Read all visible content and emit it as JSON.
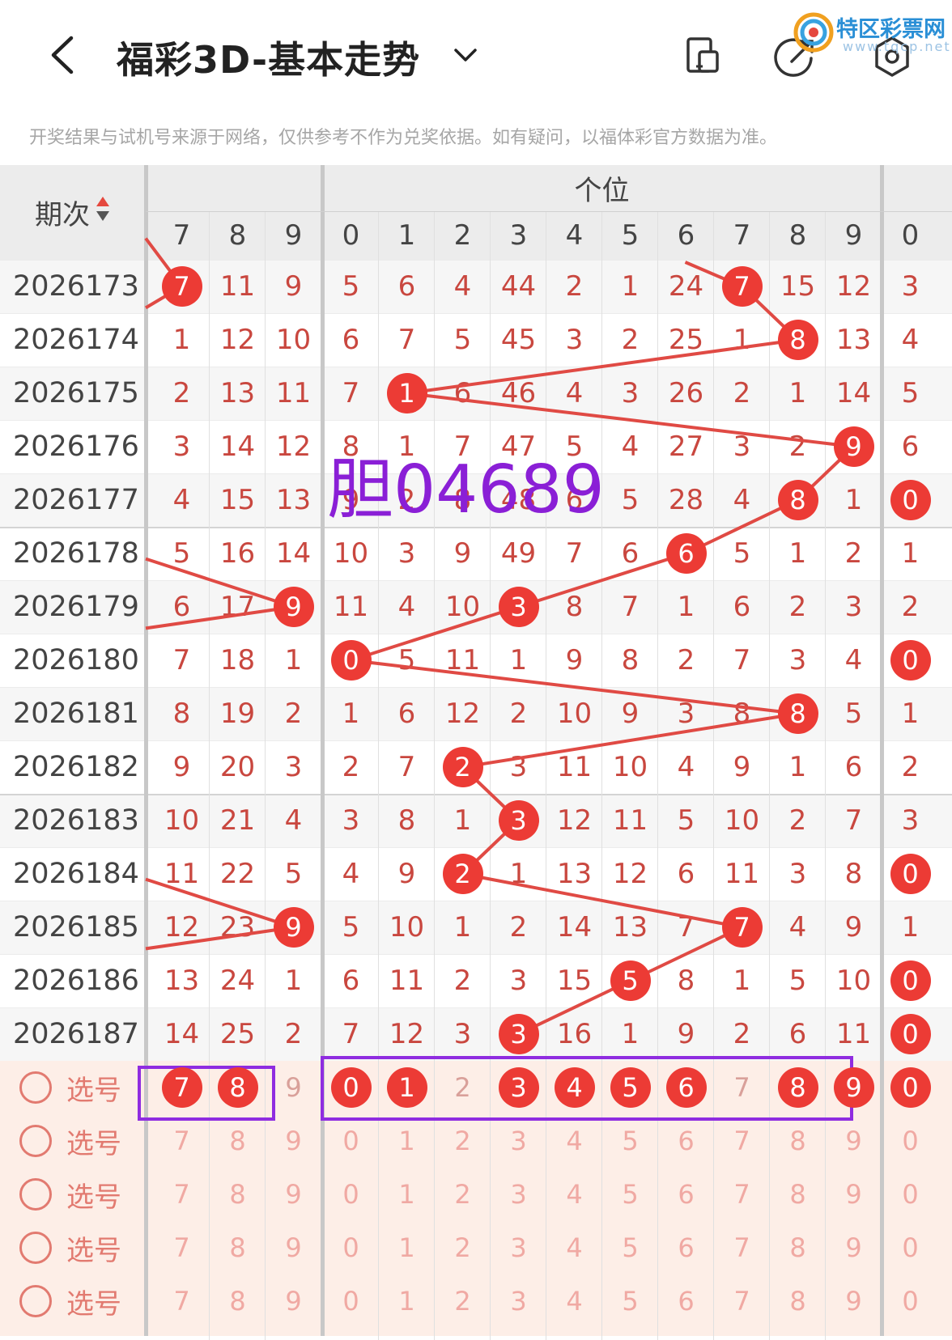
{
  "header": {
    "back_icon": "chevron-left-icon",
    "title": "福彩3D-基本走势",
    "dropdown_icon": "chevron-down-icon",
    "icons": [
      "switch-view-icon",
      "share-icon",
      "settings-icon"
    ]
  },
  "watermark": {
    "text": "特区彩票网",
    "sub": "www.tqcp.net"
  },
  "disclaimer": "开奖结果与试机号来源于网络，仅供参考不作为兑奖依据。如有疑问，以福体彩官方数据为准。",
  "table": {
    "issue_header": "期次",
    "group_label": "个位",
    "left_cols": [
      "7",
      "8",
      "9"
    ],
    "mid_cols": [
      "0",
      "1",
      "2",
      "3",
      "4",
      "5",
      "6",
      "7",
      "8",
      "9"
    ],
    "right_cols": [
      "0"
    ],
    "rows": [
      {
        "issue": "2026173",
        "left": [
          "7",
          "11",
          "9"
        ],
        "mid": [
          "5",
          "6",
          "4",
          "44",
          "2",
          "1",
          "24",
          "7",
          "15",
          "12"
        ],
        "right": [
          "3"
        ]
      },
      {
        "issue": "2026174",
        "left": [
          "1",
          "12",
          "10"
        ],
        "mid": [
          "6",
          "7",
          "5",
          "45",
          "3",
          "2",
          "25",
          "1",
          "8",
          "13"
        ],
        "right": [
          "4"
        ]
      },
      {
        "issue": "2026175",
        "left": [
          "2",
          "13",
          "11"
        ],
        "mid": [
          "7",
          "1",
          "6",
          "46",
          "4",
          "3",
          "26",
          "2",
          "1",
          "14"
        ],
        "right": [
          "5"
        ]
      },
      {
        "issue": "2026176",
        "left": [
          "3",
          "14",
          "12"
        ],
        "mid": [
          "8",
          "1",
          "7",
          "47",
          "5",
          "4",
          "27",
          "3",
          "2",
          "9"
        ],
        "right": [
          "6"
        ]
      },
      {
        "issue": "2026177",
        "left": [
          "4",
          "15",
          "13"
        ],
        "mid": [
          "9",
          "2",
          "8",
          "48",
          "6",
          "5",
          "28",
          "4",
          "8",
          "1"
        ],
        "right": [
          "0"
        ]
      },
      {
        "issue": "2026178",
        "left": [
          "5",
          "16",
          "14"
        ],
        "mid": [
          "10",
          "3",
          "9",
          "49",
          "7",
          "6",
          "6",
          "5",
          "1",
          "2"
        ],
        "right": [
          "1"
        ]
      },
      {
        "issue": "2026179",
        "left": [
          "6",
          "17",
          "9"
        ],
        "mid": [
          "11",
          "4",
          "10",
          "3",
          "8",
          "7",
          "1",
          "6",
          "2",
          "3"
        ],
        "right": [
          "2"
        ]
      },
      {
        "issue": "2026180",
        "left": [
          "7",
          "18",
          "1"
        ],
        "mid": [
          "0",
          "5",
          "11",
          "1",
          "9",
          "8",
          "2",
          "7",
          "3",
          "4"
        ],
        "right": [
          "0"
        ]
      },
      {
        "issue": "2026181",
        "left": [
          "8",
          "19",
          "2"
        ],
        "mid": [
          "1",
          "6",
          "12",
          "2",
          "10",
          "9",
          "3",
          "8",
          "8",
          "5"
        ],
        "right": [
          "1"
        ]
      },
      {
        "issue": "2026182",
        "left": [
          "9",
          "20",
          "3"
        ],
        "mid": [
          "2",
          "7",
          "2",
          "3",
          "11",
          "10",
          "4",
          "9",
          "1",
          "6"
        ],
        "right": [
          "2"
        ]
      },
      {
        "issue": "2026183",
        "left": [
          "10",
          "21",
          "4"
        ],
        "mid": [
          "3",
          "8",
          "1",
          "3",
          "12",
          "11",
          "5",
          "10",
          "2",
          "7"
        ],
        "right": [
          "3"
        ]
      },
      {
        "issue": "2026184",
        "left": [
          "11",
          "22",
          "5"
        ],
        "mid": [
          "4",
          "9",
          "2",
          "1",
          "13",
          "12",
          "6",
          "11",
          "3",
          "8"
        ],
        "right": [
          "0"
        ]
      },
      {
        "issue": "2026185",
        "left": [
          "12",
          "23",
          "9"
        ],
        "mid": [
          "5",
          "10",
          "1",
          "2",
          "14",
          "13",
          "7",
          "7",
          "4",
          "9"
        ],
        "right": [
          "1"
        ]
      },
      {
        "issue": "2026186",
        "left": [
          "13",
          "24",
          "1"
        ],
        "mid": [
          "6",
          "11",
          "2",
          "3",
          "15",
          "5",
          "8",
          "1",
          "5",
          "10"
        ],
        "right": [
          "0"
        ]
      },
      {
        "issue": "2026187",
        "left": [
          "14",
          "25",
          "2"
        ],
        "mid": [
          "7",
          "12",
          "3",
          "3",
          "16",
          "1",
          "9",
          "2",
          "6",
          "11"
        ],
        "right": [
          "0"
        ]
      }
    ],
    "select_label": "选号",
    "select_rows": [
      {
        "left": [
          "7",
          "8",
          "9"
        ],
        "mid": [
          "0",
          "1",
          "2",
          "3",
          "4",
          "5",
          "6",
          "7",
          "8",
          "9"
        ],
        "right": [
          "0"
        ],
        "hl_left": [
          true,
          true,
          false
        ],
        "hl_mid": [
          true,
          true,
          false,
          true,
          true,
          true,
          true,
          false,
          true,
          true
        ],
        "hl_right": [
          true
        ]
      },
      {
        "left": [
          "7",
          "8",
          "9"
        ],
        "mid": [
          "0",
          "1",
          "2",
          "3",
          "4",
          "5",
          "6",
          "7",
          "8",
          "9"
        ],
        "right": [
          "0"
        ]
      },
      {
        "left": [
          "7",
          "8",
          "9"
        ],
        "mid": [
          "0",
          "1",
          "2",
          "3",
          "4",
          "5",
          "6",
          "7",
          "8",
          "9"
        ],
        "right": [
          "0"
        ]
      },
      {
        "left": [
          "7",
          "8",
          "9"
        ],
        "mid": [
          "0",
          "1",
          "2",
          "3",
          "4",
          "5",
          "6",
          "7",
          "8",
          "9"
        ],
        "right": [
          "0"
        ]
      },
      {
        "left": [
          "7",
          "8",
          "9"
        ],
        "mid": [
          "0",
          "1",
          "2",
          "3",
          "4",
          "5",
          "6",
          "7",
          "8",
          "9"
        ],
        "right": [
          "0"
        ]
      }
    ]
  },
  "hits": {
    "left": {
      "2026173": "7",
      "2026179": "9",
      "2026185": "9"
    },
    "mid": [
      7,
      8,
      1,
      9,
      8,
      6,
      3,
      0,
      8,
      2,
      3,
      2,
      7,
      5,
      3
    ],
    "right_hits": [
      false,
      false,
      false,
      false,
      true,
      false,
      false,
      true,
      false,
      false,
      false,
      true,
      false,
      true,
      true
    ]
  },
  "annotation": "胆04689",
  "colors": {
    "ball": "#ec3b35",
    "line": "#e04a44",
    "annotation": "#8a1fd6",
    "box": "#8f2ce0"
  }
}
